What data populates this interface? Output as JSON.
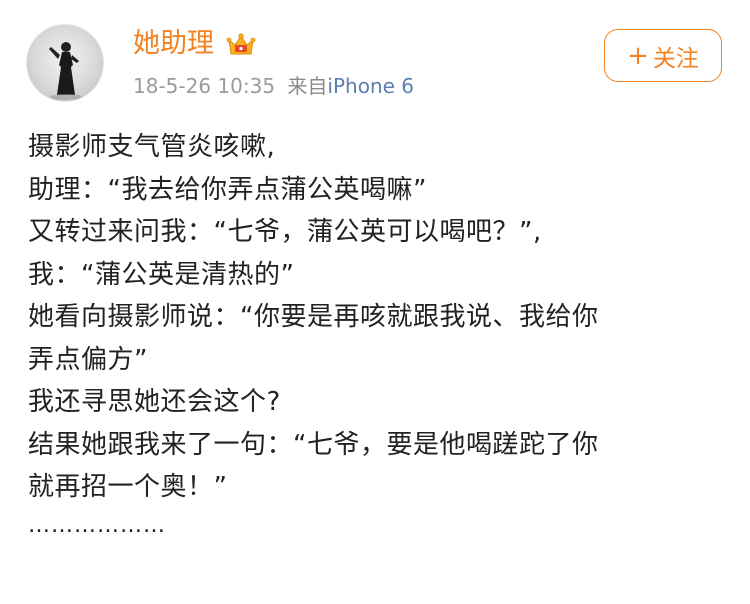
{
  "post": {
    "author": {
      "name": "她助理",
      "vip_badge_icon": "crown-vip-icon"
    },
    "meta": {
      "timestamp": "18-5-26 10:35",
      "source_prefix": "来自",
      "device": "iPhone 6"
    },
    "follow_button": {
      "icon": "plus",
      "label": "关注"
    },
    "lines": [
      "摄影师支气管炎咳嗽,",
      "助理：“我去给你弄点蒲公英喝嘛”",
      "又转过来问我：“七爷，蒲公英可以喝吧？”,",
      "我：“蒲公英是清热的”",
      "她看向摄影师说：“你要是再咳就跟我说、我给你",
      "弄点偏方”",
      "我还寻思她还会这个?",
      "结果她跟我来了一句：“七爷，要是他喝蹉跎了你",
      "就再招一个奥！”",
      "………………"
    ]
  },
  "colors": {
    "accent": "#f58220",
    "meta_text": "#9b9b9b",
    "body_text": "#222222"
  }
}
